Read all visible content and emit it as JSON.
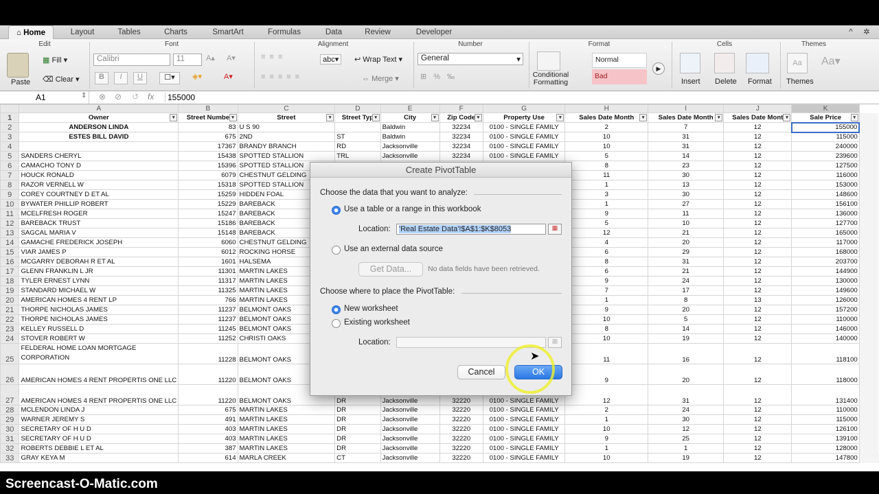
{
  "ribbon": {
    "tabs": [
      {
        "label": "Home"
      },
      {
        "label": "Layout"
      },
      {
        "label": "Tables"
      },
      {
        "label": "Charts"
      },
      {
        "label": "SmartArt"
      },
      {
        "label": "Formulas"
      },
      {
        "label": "Data"
      },
      {
        "label": "Review"
      },
      {
        "label": "Developer"
      }
    ],
    "groups": {
      "edit": "Edit",
      "font": "Font",
      "alignment": "Alignment",
      "number": "Number",
      "format": "Format",
      "cells": "Cells",
      "themes": "Themes"
    },
    "paste": "Paste",
    "fill": "Fill",
    "clear": "Clear",
    "font_name": "Calibri",
    "font_size": "11",
    "wrap_text": "Wrap Text",
    "merge": "Merge",
    "abc": "abc",
    "number_format": "General",
    "conditional_formatting": "Conditional Formatting",
    "style_normal": "Normal",
    "style_bad": "Bad",
    "insert": "Insert",
    "delete": "Delete",
    "format": "Format",
    "themes": "Themes"
  },
  "formula_bar": {
    "cell_ref": "A1",
    "fx": "fx",
    "value": "155000"
  },
  "columns": [
    "A",
    "B",
    "C",
    "D",
    "E",
    "F",
    "G",
    "H",
    "I",
    "J",
    "K"
  ],
  "headers": [
    "Owner",
    "Street Numbe",
    "Street",
    "Street Typ",
    "City",
    "Zip Code",
    "Property Use",
    "Sales Date Month",
    "Sales Date Month",
    "Sales Date Mont",
    "Sale Price"
  ],
  "rows": [
    {
      "n": "2",
      "c": [
        "ANDERSON LINDA",
        "83",
        "U S 90",
        "",
        "Baldwin",
        "32234",
        "0100 - SINGLE FAMILY",
        "2",
        "7",
        "12",
        "155000"
      ]
    },
    {
      "n": "3",
      "c": [
        "ESTES BILL DAVID",
        "675",
        "2ND",
        "ST",
        "Baldwin",
        "32234",
        "0100 - SINGLE FAMILY",
        "10",
        "31",
        "12",
        "115000"
      ]
    },
    {
      "n": "4",
      "c": [
        "",
        "17367",
        "BRANDY BRANCH",
        "RD",
        "Jacksonville",
        "32234",
        "0100 - SINGLE FAMILY",
        "10",
        "31",
        "12",
        "240000"
      ]
    },
    {
      "n": "5",
      "c": [
        "SANDERS CHERYL",
        "15438",
        "SPOTTED STALLION",
        "TRL",
        "Jacksonville",
        "32234",
        "0100 - SINGLE FAMILY",
        "5",
        "14",
        "12",
        "239600"
      ]
    },
    {
      "n": "6",
      "c": [
        "CAMACHO TONY D",
        "15396",
        "SPOTTED STALLION",
        "",
        "",
        "",
        "",
        "8",
        "23",
        "12",
        "127500"
      ]
    },
    {
      "n": "7",
      "c": [
        "HOUCK RONALD",
        "6079",
        "CHESTNUT GELDING",
        "",
        "",
        "",
        "",
        "11",
        "30",
        "12",
        "116000"
      ]
    },
    {
      "n": "8",
      "c": [
        "RAZOR VERNELL W",
        "15318",
        "SPOTTED STALLION",
        "",
        "",
        "",
        "",
        "1",
        "13",
        "12",
        "153000"
      ]
    },
    {
      "n": "9",
      "c": [
        "COREY COURTNEY D ET AL",
        "15259",
        "HIDDEN FOAL",
        "",
        "",
        "",
        "",
        "3",
        "30",
        "12",
        "148600"
      ]
    },
    {
      "n": "10",
      "c": [
        "BYWATER PHILLIP ROBERT",
        "15229",
        "BAREBACK",
        "",
        "",
        "",
        "",
        "1",
        "27",
        "12",
        "156100"
      ]
    },
    {
      "n": "11",
      "c": [
        "MCELFRESH ROGER",
        "15247",
        "BAREBACK",
        "",
        "",
        "",
        "",
        "9",
        "11",
        "12",
        "136000"
      ]
    },
    {
      "n": "12",
      "c": [
        "BAREBACK TRUST",
        "15186",
        "BAREBACK",
        "",
        "",
        "",
        "",
        "5",
        "10",
        "12",
        "127700"
      ]
    },
    {
      "n": "13",
      "c": [
        "SAGCAL MARIA V",
        "15148",
        "BAREBACK",
        "",
        "",
        "",
        "",
        "12",
        "21",
        "12",
        "165000"
      ]
    },
    {
      "n": "14",
      "c": [
        "GAMACHE FREDERICK JOSEPH",
        "6060",
        "CHESTNUT GELDING",
        "",
        "",
        "",
        "",
        "4",
        "20",
        "12",
        "117000"
      ]
    },
    {
      "n": "15",
      "c": [
        "VIAR JAMES P",
        "6012",
        "ROCKING HORSE",
        "",
        "",
        "",
        "",
        "6",
        "29",
        "12",
        "168000"
      ]
    },
    {
      "n": "16",
      "c": [
        "MCGARRY DEBORAH R ET AL",
        "1601",
        "HALSEMA",
        "",
        "",
        "",
        "",
        "8",
        "31",
        "12",
        "203700"
      ]
    },
    {
      "n": "17",
      "c": [
        "GLENN FRANKLIN L JR",
        "11301",
        "MARTIN LAKES",
        "",
        "",
        "",
        "",
        "6",
        "21",
        "12",
        "144900"
      ]
    },
    {
      "n": "18",
      "c": [
        "TYLER ERNEST LYNN",
        "11317",
        "MARTIN LAKES",
        "",
        "",
        "",
        "",
        "9",
        "24",
        "12",
        "130000"
      ]
    },
    {
      "n": "19",
      "c": [
        "STANDARD MICHAEL W",
        "11325",
        "MARTIN LAKES",
        "",
        "",
        "",
        "",
        "7",
        "17",
        "12",
        "149600"
      ]
    },
    {
      "n": "20",
      "c": [
        "AMERICAN HOMES 4 RENT LP",
        "766",
        "MARTIN LAKES",
        "",
        "",
        "",
        "",
        "1",
        "8",
        "13",
        "126000"
      ]
    },
    {
      "n": "21",
      "c": [
        "THORPE NICHOLAS JAMES",
        "11237",
        "BELMONT OAKS",
        "",
        "",
        "",
        "",
        "9",
        "20",
        "12",
        "157200"
      ]
    },
    {
      "n": "22",
      "c": [
        "THORPE NICHOLAS JAMES",
        "11237",
        "BELMONT OAKS",
        "",
        "",
        "",
        "",
        "10",
        "5",
        "12",
        "110000"
      ]
    },
    {
      "n": "23",
      "c": [
        "KELLEY RUSSELL D",
        "11245",
        "BELMONT OAKS",
        "",
        "",
        "",
        "",
        "8",
        "14",
        "12",
        "146000"
      ]
    },
    {
      "n": "24",
      "c": [
        "STOVER ROBERT W",
        "11252",
        "CHRISTI OAKS",
        "",
        "",
        "",
        "",
        "10",
        "19",
        "12",
        "140000"
      ]
    },
    {
      "n": "25",
      "tall": true,
      "c": [
        "FELDERAL HOME LOAN MORTGAGE CORPORATION",
        "11228",
        "BELMONT OAKS",
        "",
        "",
        "",
        "",
        "11",
        "16",
        "12",
        "118100"
      ]
    },
    {
      "n": "26",
      "tall": true,
      "c": [
        "AMERICAN HOMES 4 RENT PROPERTIS ONE LLC",
        "11220",
        "BELMONT OAKS",
        "",
        "",
        "",
        "",
        "9",
        "20",
        "12",
        "118000"
      ]
    },
    {
      "n": "27",
      "tall": true,
      "c": [
        "AMERICAN HOMES 4 RENT PROPERTIS ONE LLC",
        "11220",
        "BELMONT OAKS",
        "DR",
        "Jacksonville",
        "32220",
        "0100 - SINGLE FAMILY",
        "12",
        "31",
        "12",
        "131400"
      ]
    },
    {
      "n": "28",
      "c": [
        "MCLENDON LINDA J",
        "675",
        "MARTIN LAKES",
        "DR",
        "Jacksonville",
        "32220",
        "0100 - SINGLE FAMILY",
        "2",
        "24",
        "12",
        "110000"
      ]
    },
    {
      "n": "29",
      "c": [
        "WARNER JEREMY S",
        "491",
        "MARTIN LAKES",
        "DR",
        "Jacksonville",
        "32220",
        "0100 - SINGLE FAMILY",
        "1",
        "30",
        "12",
        "115000"
      ]
    },
    {
      "n": "30",
      "c": [
        "SECRETARY OF H U D",
        "403",
        "MARTIN LAKES",
        "DR",
        "Jacksonville",
        "32220",
        "0100 - SINGLE FAMILY",
        "10",
        "12",
        "12",
        "126100"
      ]
    },
    {
      "n": "31",
      "c": [
        "SECRETARY OF H U D",
        "403",
        "MARTIN LAKES",
        "DR",
        "Jacksonville",
        "32220",
        "0100 - SINGLE FAMILY",
        "9",
        "25",
        "12",
        "139100"
      ]
    },
    {
      "n": "32",
      "c": [
        "ROBERTS DEBBIE L ET AL",
        "387",
        "MARTIN LAKES",
        "DR",
        "Jacksonville",
        "32220",
        "0100 - SINGLE FAMILY",
        "1",
        "1",
        "12",
        "128000"
      ]
    },
    {
      "n": "33",
      "c": [
        "GRAY KEYA M",
        "614",
        "MARLA CREEK",
        "CT",
        "Jacksonville",
        "32220",
        "0100 - SINGLE FAMILY",
        "10",
        "19",
        "12",
        "147800"
      ]
    }
  ],
  "dialog": {
    "title": "Create PivotTable",
    "section1": "Choose the data that you want to analyze:",
    "opt_table": "Use a table or a range in this workbook",
    "location_label": "Location:",
    "location_value": "'Real Estate Data'!$A$1:$K$8053",
    "opt_external": "Use an external data source",
    "get_data": "Get Data...",
    "no_fields": "No data fields have been retrieved.",
    "section2": "Choose where to place the PivotTable:",
    "opt_new": "New worksheet",
    "opt_existing": "Existing worksheet",
    "location2_label": "Location:",
    "cancel": "Cancel",
    "ok": "OK"
  },
  "watermark": "Screencast-O-Matic.com"
}
